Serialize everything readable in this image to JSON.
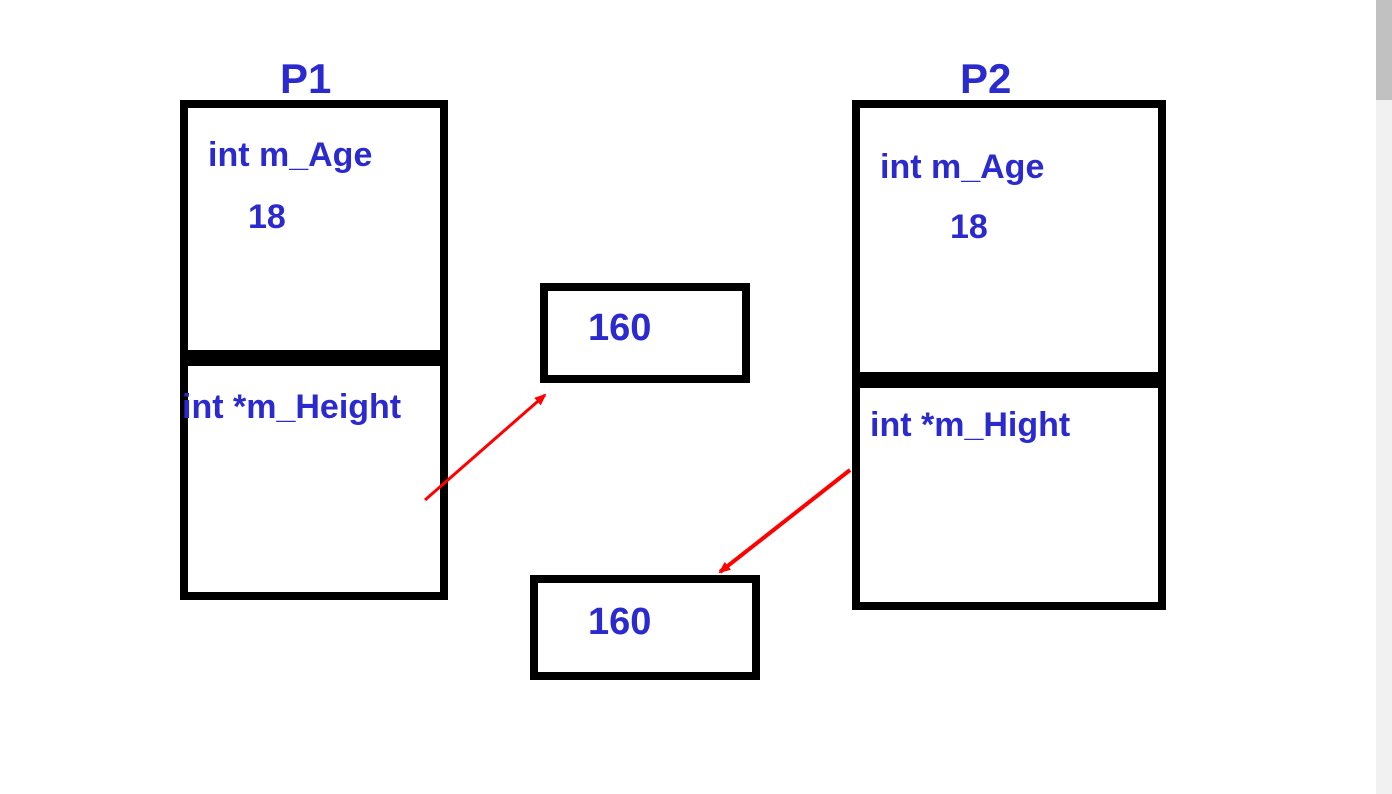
{
  "p1": {
    "title": "P1",
    "age_label": "int m_Age",
    "age_value": "18",
    "height_label": "int *m_Height"
  },
  "p2": {
    "title": "P2",
    "age_label": "int m_Age",
    "age_value": "18",
    "height_label": "int *m_Hight"
  },
  "heap1": {
    "value": "160"
  },
  "heap2": {
    "value": "160"
  }
}
